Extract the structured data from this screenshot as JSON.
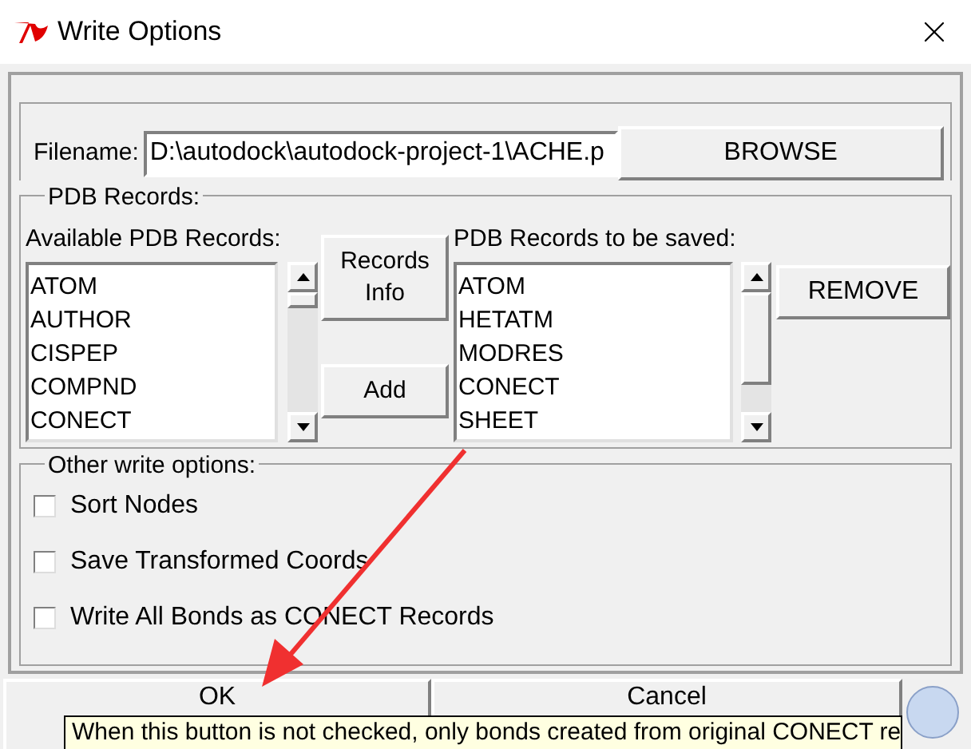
{
  "window": {
    "title": "Write Options"
  },
  "filename": {
    "label": "Filename:",
    "value": "D:\\autodock\\autodock-project-1\\ACHE.p",
    "browse": "BROWSE"
  },
  "pdb_records": {
    "title": "PDB Records:",
    "available_label": "Available PDB Records:",
    "available": [
      "ATOM",
      "AUTHOR",
      "CISPEP",
      "COMPND",
      "CONECT"
    ],
    "records_info": "Records Info",
    "add": "Add",
    "saved_label": "PDB Records to be saved:",
    "saved": [
      "ATOM",
      "HETATM",
      "MODRES",
      "CONECT",
      "SHEET"
    ],
    "remove": "REMOVE"
  },
  "other_options": {
    "title": "Other write options:",
    "items": [
      {
        "label": "Sort Nodes",
        "checked": false
      },
      {
        "label": "Save Transformed Coords",
        "checked": false
      },
      {
        "label": "Write All Bonds as CONECT Records",
        "checked": false
      }
    ]
  },
  "buttons": [
    "OK",
    "Cancel"
  ],
  "tooltip": "When this button is not checked, only bonds created from original CONECT re"
}
